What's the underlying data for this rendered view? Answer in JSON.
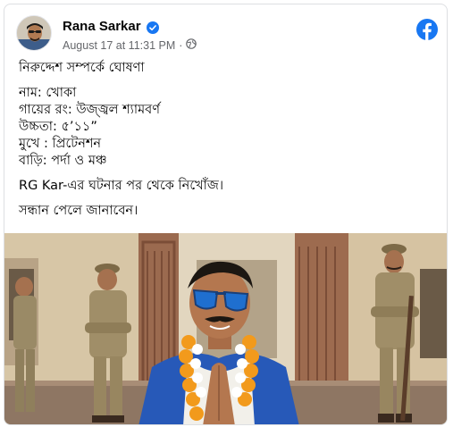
{
  "post": {
    "author": "Rana Sarkar",
    "timestamp": "August 17 at 11:31 PM",
    "separator": "·",
    "lines": [
      "নিরুদ্দেশ সম্পর্কে ঘোষণা",
      "নাম: খোকা",
      "গায়ের রং: উজ্জ্বল শ্যামবর্ণ",
      "উচ্চতা: ৫’১১”",
      "মুখে : প্রিটেনশন",
      "বাড়ি: পর্দা ও মঞ্চ",
      "RG Kar-এর ঘটনার পর থেকে নিখোঁজ।",
      "সন্ধান পেলে জানাবেন।"
    ]
  },
  "icons": {
    "verified": "verified-badge-icon",
    "audience": "globe-icon",
    "brand": "facebook-logo-icon"
  },
  "colors": {
    "facebook_blue": "#1877f2",
    "meta_gray": "#65676b"
  }
}
